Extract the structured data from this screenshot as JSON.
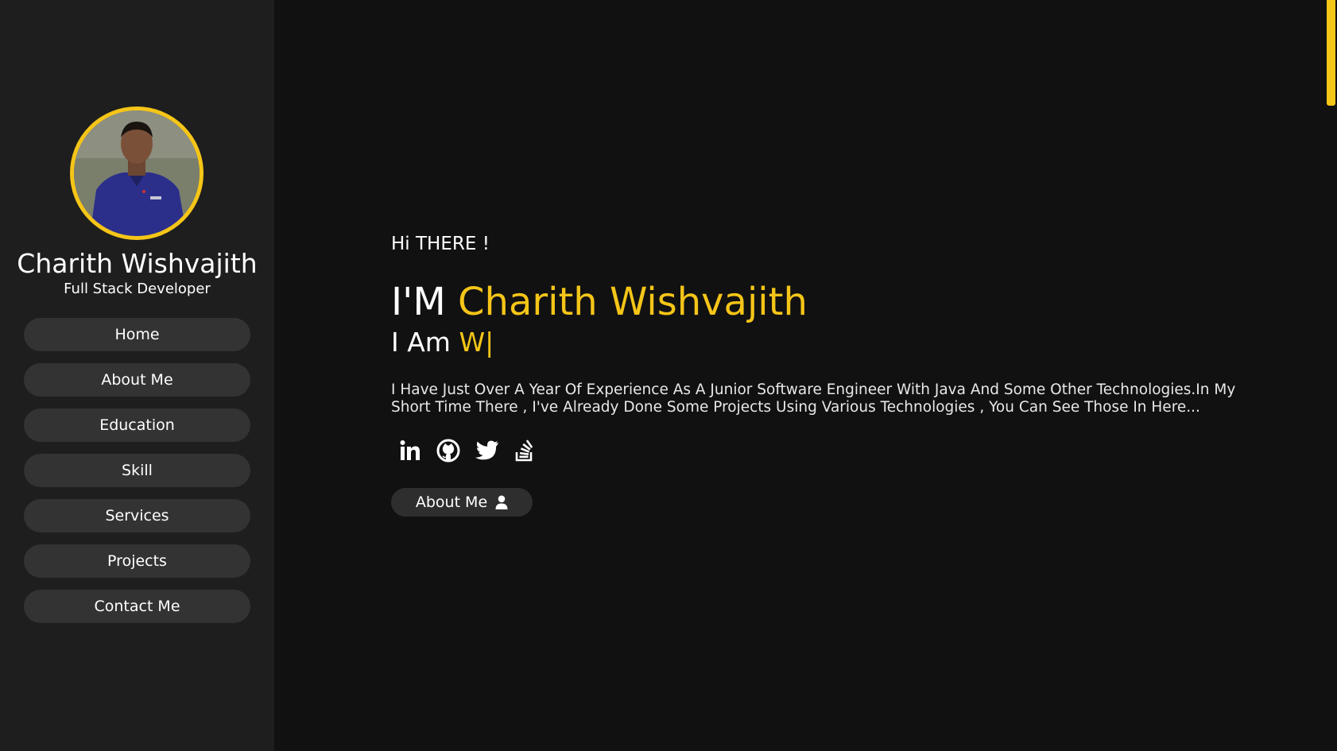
{
  "theme": {
    "accent": "#f5c518",
    "sidebar_bg": "#1e1e1e",
    "main_bg": "#111111",
    "button_bg": "#333333"
  },
  "sidebar": {
    "name": "Charith Wishvajith",
    "role": "Full Stack Developer",
    "nav": [
      {
        "label": "Home"
      },
      {
        "label": "About Me"
      },
      {
        "label": "Education"
      },
      {
        "label": "Skill"
      },
      {
        "label": "Services"
      },
      {
        "label": "Projects"
      },
      {
        "label": "Contact Me"
      }
    ]
  },
  "hero": {
    "greeting": "Hi THERE !",
    "headline_prefix": "I'M ",
    "headline_name": "Charith Wishvajith",
    "typed_prefix": "I Am ",
    "typed_text": "W|",
    "bio": "I Have Just Over A Year Of Experience As A Junior Software Engineer With Java And Some Other Technologies.In My Short Time There , I've Already Done Some Projects Using Various Technologies , You Can See Those In Here...",
    "socials": [
      {
        "icon": "linkedin-icon"
      },
      {
        "icon": "github-icon"
      },
      {
        "icon": "twitter-icon"
      },
      {
        "icon": "stackoverflow-icon"
      }
    ],
    "about_button_label": "About Me",
    "about_button_icon": "user-icon"
  }
}
